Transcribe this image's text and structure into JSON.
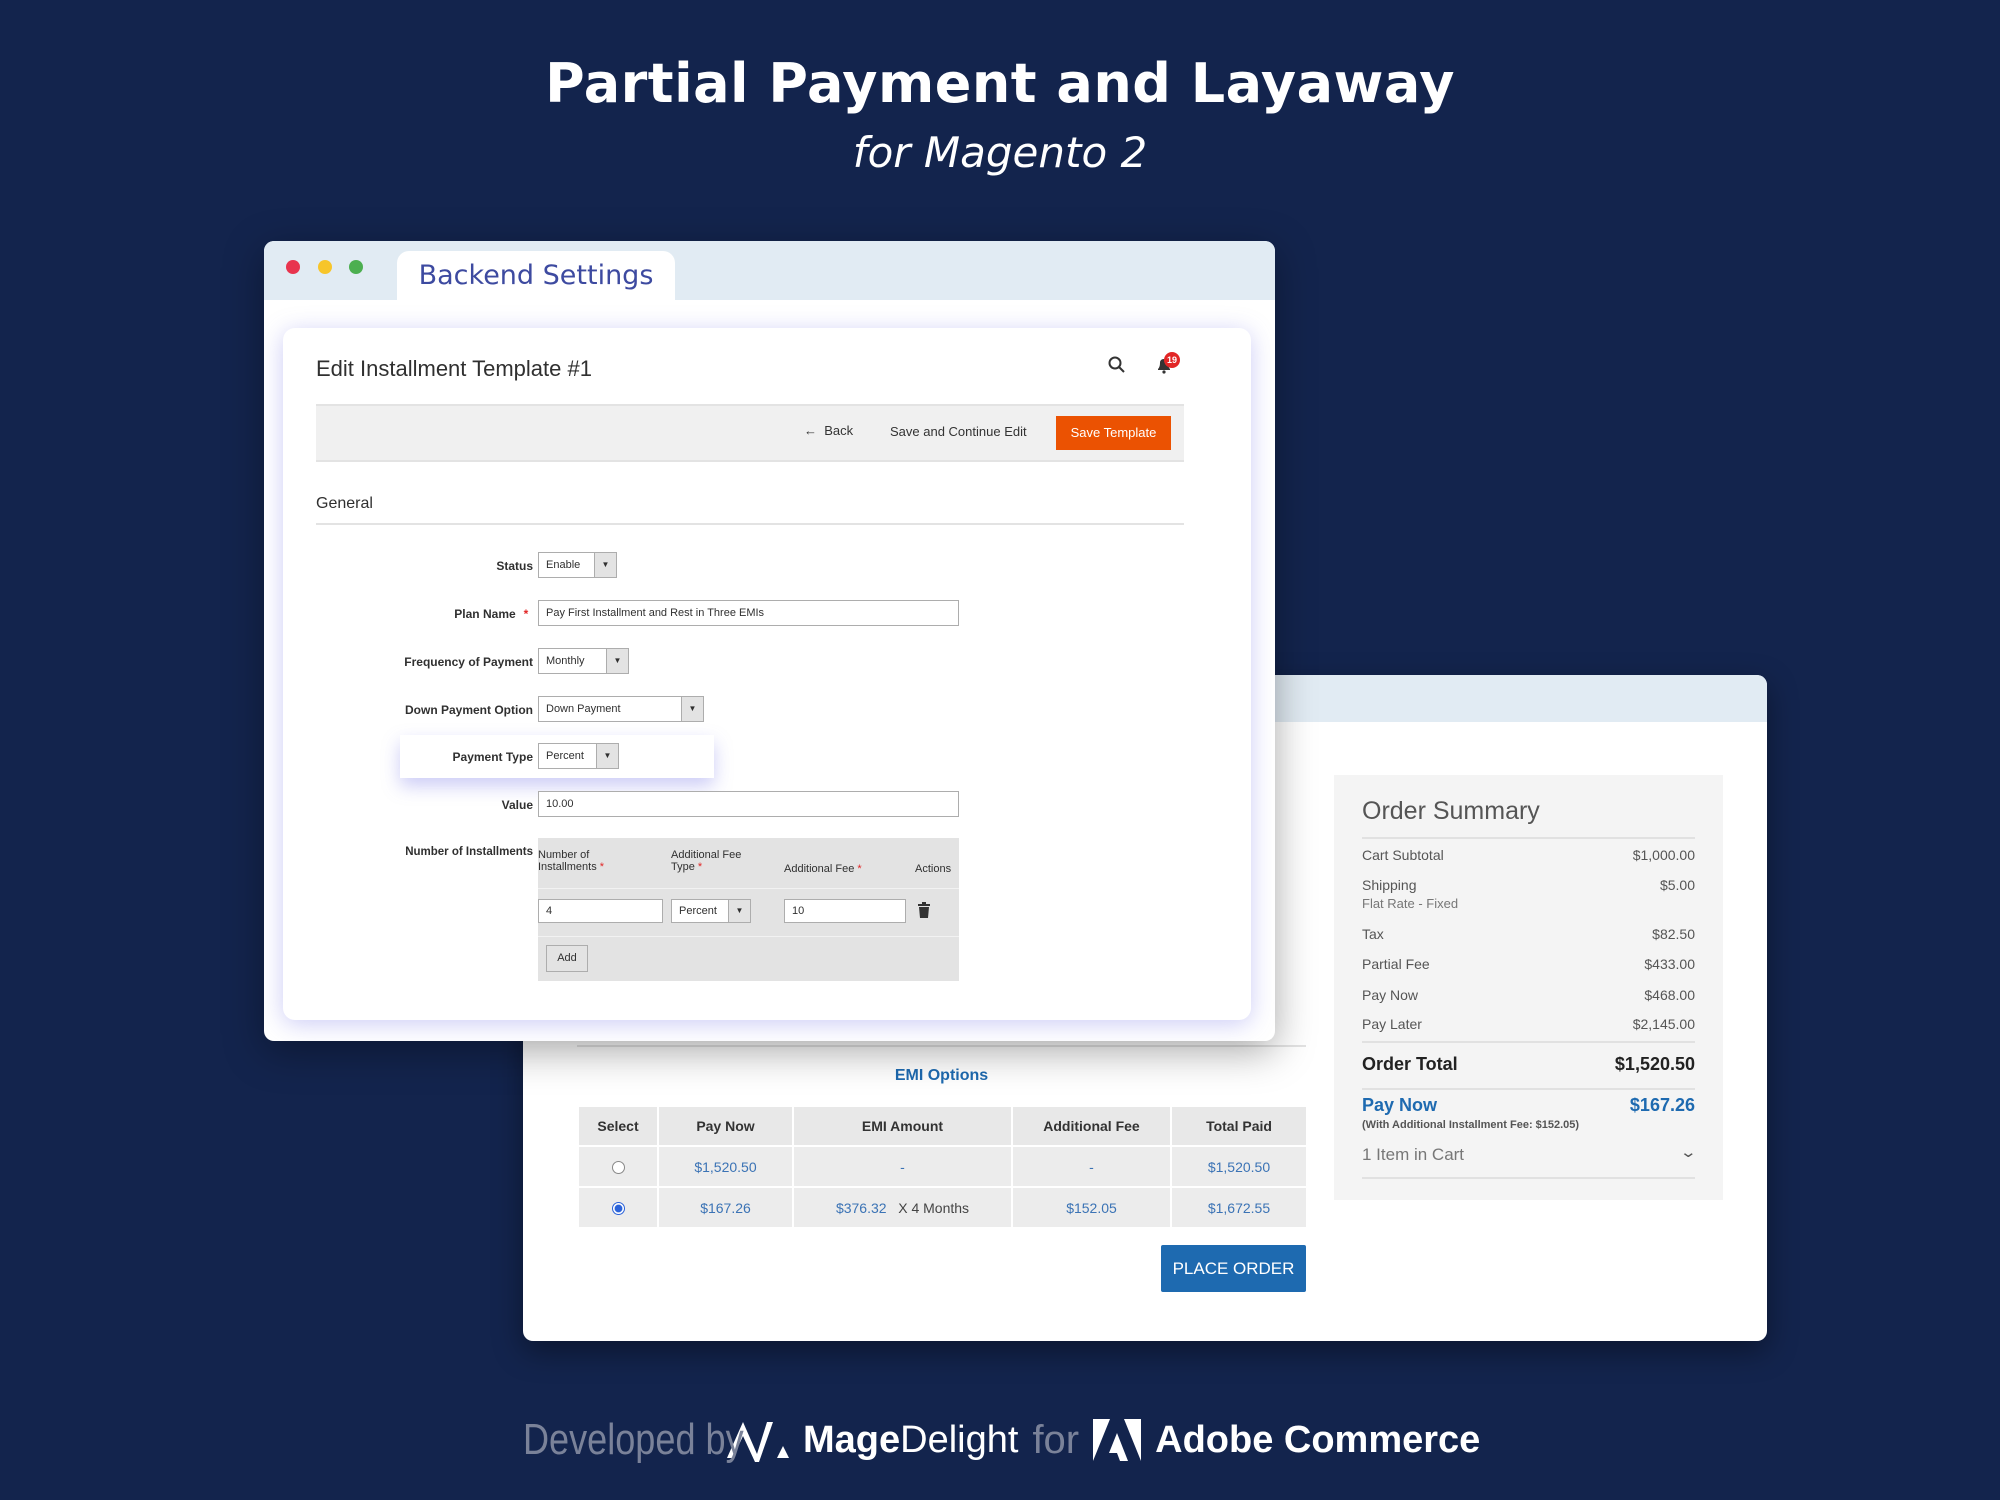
{
  "hero": {
    "title": "Partial Payment and Layaway",
    "subtitle": "for Magento 2"
  },
  "backend": {
    "tab_label": "Backend Settings",
    "window_dots": [
      "#e8344e",
      "#f7c52a",
      "#4caf50"
    ],
    "page_title": "Edit Installment Template #1",
    "notification_count": "19",
    "actions": {
      "back": "Back",
      "save_continue": "Save and Continue Edit",
      "save_template": "Save Template"
    },
    "section": "General",
    "fields": {
      "status": {
        "label": "Status",
        "value": "Enable"
      },
      "plan_name": {
        "label": "Plan Name",
        "value": "Pay First Installment and Rest in Three EMIs"
      },
      "frequency": {
        "label": "Frequency of Payment",
        "value": "Monthly"
      },
      "down_payment": {
        "label": "Down Payment Option",
        "value": "Down Payment"
      },
      "payment_type": {
        "label": "Payment Type",
        "value": "Percent"
      },
      "value": {
        "label": "Value",
        "value": "10.00"
      },
      "installments": {
        "label": "Number of Installments"
      }
    },
    "installment_table": {
      "headers": [
        "Number of Installments",
        "Additional Fee Type",
        "Additional Fee",
        "Actions"
      ],
      "row": {
        "count": "4",
        "fee_type": "Percent",
        "fee": "10"
      },
      "add_label": "Add"
    },
    "accent": "#eb5202"
  },
  "frontend": {
    "emi_title": "EMI Options",
    "emi_headers": [
      "Select",
      "Pay Now",
      "EMI Amount",
      "Additional Fee",
      "Total Paid"
    ],
    "emi_rows": [
      {
        "selected": false,
        "pay_now": "$1,520.50",
        "emi_amount": "-",
        "emi_suffix": "",
        "fee": "-",
        "total": "$1,520.50"
      },
      {
        "selected": true,
        "pay_now": "$167.26",
        "emi_amount": "$376.32",
        "emi_suffix": "X 4 Months",
        "fee": "$152.05",
        "total": "$1,672.55"
      }
    ],
    "place_order": "PLACE ORDER",
    "summary": {
      "title": "Order Summary",
      "rows": [
        {
          "label": "Cart Subtotal",
          "value": "$1,000.00"
        },
        {
          "label": "Shipping",
          "value": "$5.00",
          "sub": "Flat Rate - Fixed"
        },
        {
          "label": "Tax",
          "value": "$82.50"
        },
        {
          "label": "Partial Fee",
          "value": "$433.00"
        },
        {
          "label": "Pay Now",
          "value": "$468.00"
        },
        {
          "label": "Pay Later",
          "value": "$2,145.00"
        }
      ],
      "order_total": {
        "label": "Order Total",
        "value": "$1,520.50"
      },
      "pay_now": {
        "label": "Pay Now",
        "value": "$167.26",
        "note": "(With Additional Installment Fee: $152.05)"
      },
      "items": "1 Item in Cart"
    },
    "accent": "#1e6ab0"
  },
  "footer": {
    "developed_by": "Developed by",
    "brand": "MageDelight",
    "brand_bold": "Mage",
    "brand_light": "Delight",
    "for": "for",
    "platform": "Adobe Commerce"
  }
}
